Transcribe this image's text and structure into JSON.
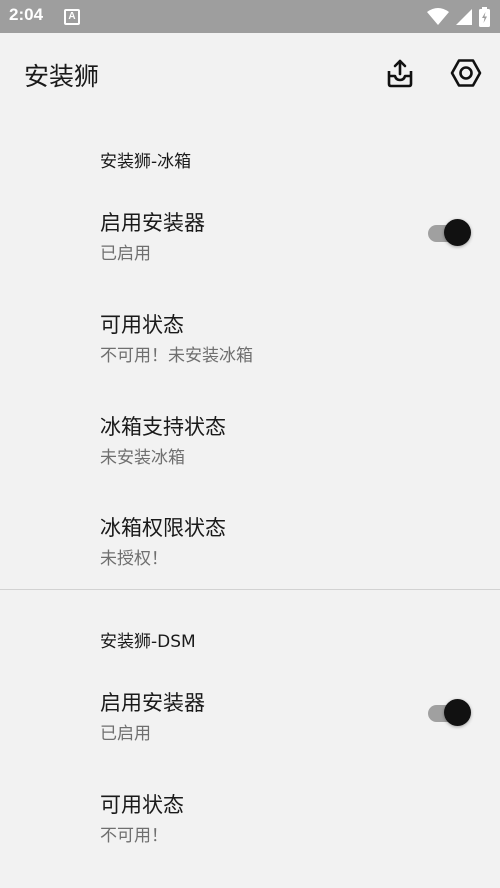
{
  "status_bar": {
    "time": "2:04",
    "notification_letter": "A",
    "icons": [
      "wifi-icon",
      "signal-icon",
      "battery-icon"
    ]
  },
  "app_bar": {
    "title": "安装狮",
    "actions": [
      "share-icon",
      "settings-icon"
    ]
  },
  "sections": [
    {
      "header": "安装狮-冰箱",
      "items": [
        {
          "title": "启用安装器",
          "summary": "已启用",
          "toggle": true
        },
        {
          "title": "可用状态",
          "summary": "不可用！未安装冰箱"
        },
        {
          "title": "冰箱支持状态",
          "summary": "未安装冰箱"
        },
        {
          "title": "冰箱权限状态",
          "summary": "未授权！"
        }
      ]
    },
    {
      "header": "安装狮-DSM",
      "items": [
        {
          "title": "启用安装器",
          "summary": "已启用",
          "toggle": true
        },
        {
          "title": "可用状态",
          "summary": "不可用！"
        }
      ]
    }
  ],
  "colors": {
    "status_bar": "#9e9e9e",
    "background": "#f2f2f2",
    "switch_thumb": "#111111",
    "switch_track": "#a0a0a0",
    "summary_text": "#6f6f6f"
  }
}
